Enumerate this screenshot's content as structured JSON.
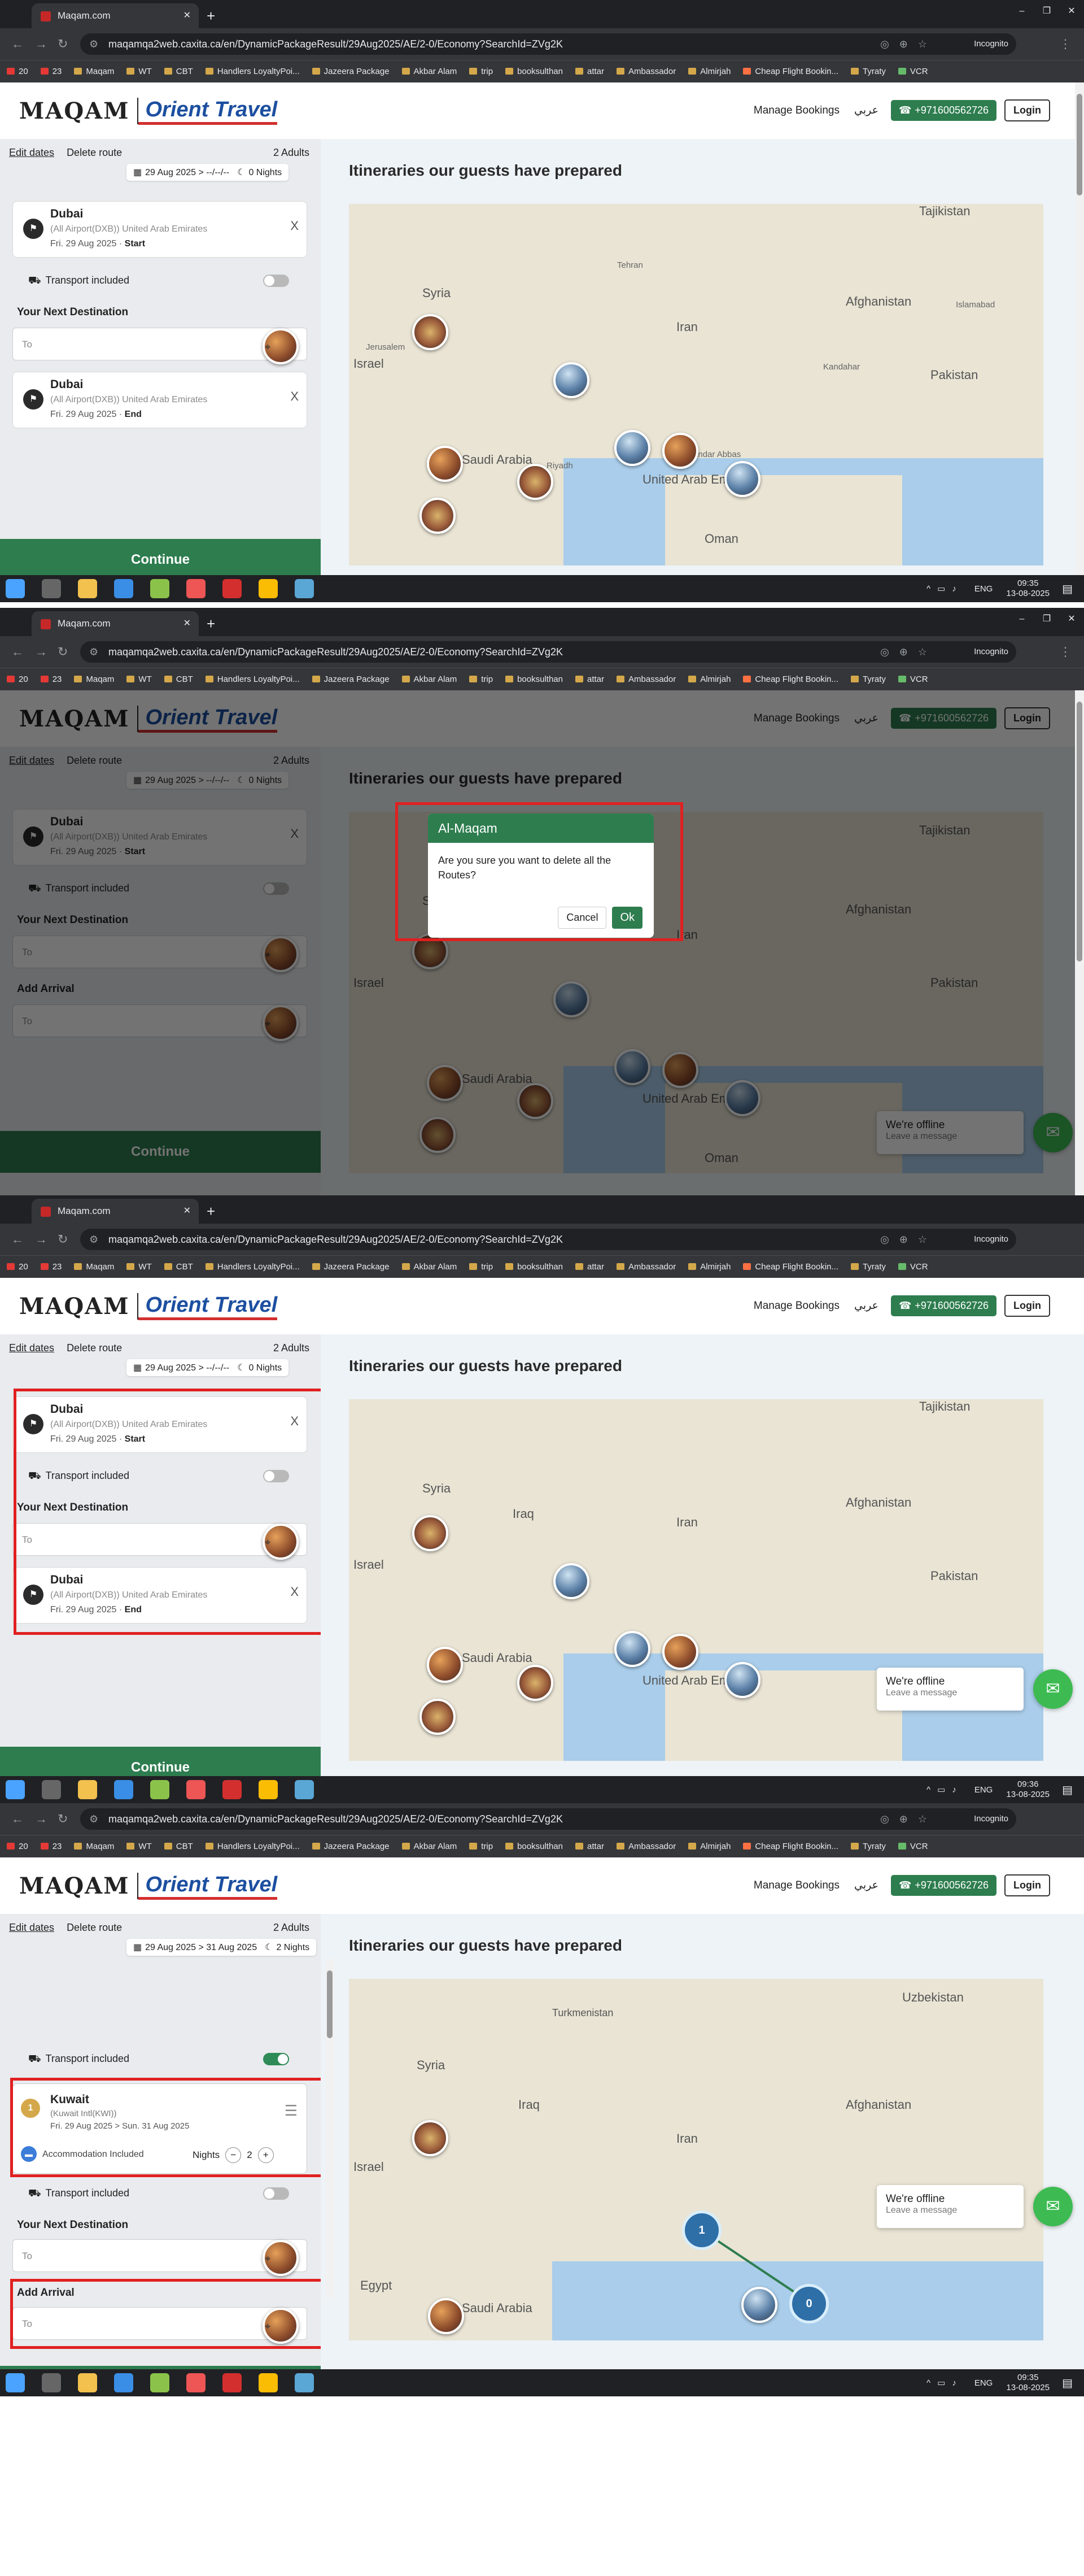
{
  "browser": {
    "tab_title": "Maqam.com",
    "new_tab": "+",
    "window_controls": {
      "minimize": "–",
      "restore": "❐",
      "close": "✕"
    },
    "url_1": "maqamqa2web.caxita.ca/en/DynamicPackageResult/29Aug2025/AE/2-0/Economy?SearchId=ZVg2K",
    "url_2": "maqamqa2web.caxita.ca/en/DynamicPackageResult/29Aug2025/AE/2-0/Economy?SearchId=ZVg2K",
    "incognito": "Incognito",
    "bookmarks": [
      "20",
      "23",
      "Maqam",
      "WT",
      "CBT",
      "Handlers LoyaltyPoi...",
      "Jazeera Package",
      "Akbar Alam",
      "trip",
      "booksulthan",
      "attar",
      "Ambassador",
      "Almirjah",
      "Cheap Flight Bookin...",
      "Tyraty",
      "VCR"
    ]
  },
  "site": {
    "logo_arabic": "MAQAM",
    "logo_english": "Orient Travel",
    "manage_bookings": "Manage Bookings",
    "arabic": "عربي",
    "phone": "+971600562726",
    "login": "Login",
    "edit_dates": "Edit dates",
    "delete_route": "Delete route",
    "adults": "2 Adults",
    "itineraries_title": "Itineraries our guests have prepared",
    "transport_included": "Transport included",
    "your_next_destination": "Your Next Destination",
    "add_arrival": "Add Arrival",
    "to_placeholder": "To",
    "continue": "Continue"
  },
  "route_a": {
    "dates": "29 Aug 2025 > --/--/--",
    "nights": "0 Nights",
    "start": {
      "city": "Dubai",
      "airport": "(All Airport(DXB)) United Arab Emirates",
      "date": "Fri. 29 Aug 2025 ·",
      "tag": "Start"
    },
    "end": {
      "city": "Dubai",
      "airport": "(All Airport(DXB)) United Arab Emirates",
      "date": "Fri. 29 Aug 2025 ·",
      "tag": "End"
    }
  },
  "route_b": {
    "dates": "29 Aug 2025 > 31 Aug 2025",
    "nights": "2 Nights",
    "stop": {
      "num": "1",
      "city": "Kuwait",
      "airport": "(Kuwait Intl(KWI))",
      "date": "Fri. 29 Aug 2025 > Sun. 31 Aug 2025",
      "accommodation": "Accommodation Included",
      "nights_label": "Nights",
      "nights_value": "2",
      "minus": "−",
      "plus": "+"
    }
  },
  "dialog": {
    "title": "Al-Maqam",
    "message": "Are you sure you want to delete all the Routes?",
    "cancel": "Cancel",
    "ok": "Ok"
  },
  "chat": {
    "title": "We're offline",
    "subtitle": "Leave a message"
  },
  "map": {
    "labels": [
      "Syria",
      "Iraq",
      "Iran",
      "Afghanistan",
      "Pakistan",
      "Tajikistan",
      "Jerusalem",
      "Israel",
      "Saudi Arabia",
      "United Arab Emirates",
      "Oman",
      "Riyadh",
      "Tehran",
      "Islamabad",
      "Kandahar",
      "Bandar Abbas",
      "Turkmenistan",
      "Uzbekistan",
      "Egypt",
      "Kuwait"
    ],
    "clusters": [
      "1",
      "0"
    ]
  },
  "taskbar": {
    "lang": "ENG",
    "time_1": "09:35",
    "date_1": "13-08-2025",
    "time_2": "09:36",
    "date_2": "13-08-2025",
    "time_3": "09:35",
    "date_3": "13-08-2025"
  },
  "icons": {
    "close": "X",
    "flag": "⚑",
    "pin": "⌖",
    "transport": "⛟",
    "calendar": "📅",
    "moon": "☾",
    "chat": "💬",
    "hamburger": "☰",
    "bed": "🛏"
  }
}
